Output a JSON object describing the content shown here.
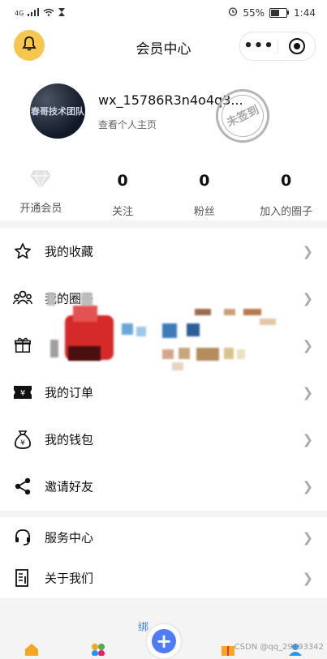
{
  "status_bar": {
    "signal_label": "4G",
    "battery_percent": "55%",
    "time": "1:44"
  },
  "header": {
    "title": "会员中心",
    "more_label": "•••"
  },
  "profile": {
    "username": "wx_15786R3n4o4q3...",
    "profile_link": "查看个人主页",
    "stamp_text": "未签到",
    "avatar_text_line1": "春哥技术团队"
  },
  "stats": [
    {
      "value": "",
      "label": "开通会员",
      "icon": "diamond-icon"
    },
    {
      "value": "0",
      "label": "关注"
    },
    {
      "value": "0",
      "label": "粉丝"
    },
    {
      "value": "0",
      "label": "加入的圈子"
    }
  ],
  "menu_main": [
    {
      "label": "我的收藏",
      "icon": "star-icon"
    },
    {
      "label": "我的圈子",
      "icon": "group-icon"
    },
    {
      "label": "",
      "icon": "gift-icon"
    },
    {
      "label": "我的订单",
      "icon": "ticket-icon"
    },
    {
      "label": "我的钱包",
      "icon": "money-bag-icon"
    },
    {
      "label": "邀请好友",
      "icon": "share-icon"
    }
  ],
  "menu_secondary": [
    {
      "label": "服务中心",
      "icon": "headset-icon"
    },
    {
      "label": "关于我们",
      "icon": "document-icon"
    }
  ],
  "tabbar": {
    "hint": "绑",
    "plus": "+",
    "watermark": "CSDN @qq_29093342"
  },
  "colors": {
    "accent": "#f6c64f",
    "plus": "#4f7cf6"
  }
}
